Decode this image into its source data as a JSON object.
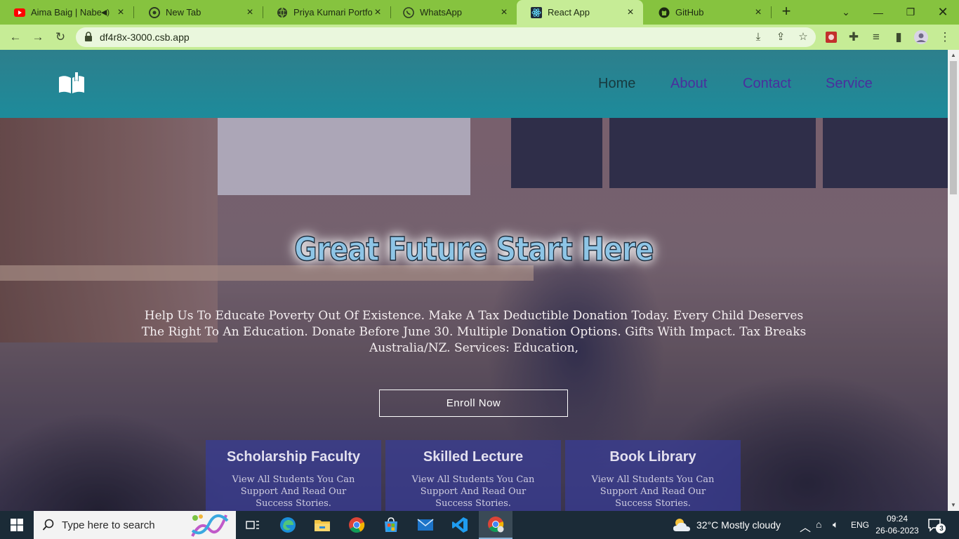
{
  "browser": {
    "tabs": [
      {
        "title": "Aima Baig | Nabeel",
        "icon": "youtube-icon"
      },
      {
        "title": "New Tab",
        "icon": "chrome-icon"
      },
      {
        "title": "Priya Kumari Portfolio",
        "icon": "globe-icon"
      },
      {
        "title": "WhatsApp",
        "icon": "whatsapp-icon"
      },
      {
        "title": "React App",
        "icon": "react-icon",
        "active": true
      },
      {
        "title": "GitHub",
        "icon": "github-icon"
      }
    ],
    "url": "df4r8x-3000.csb.app",
    "accent_color": "#86c33f",
    "toolbar_color": "#c6ec96"
  },
  "site": {
    "nav": {
      "home": "Home",
      "about": "About",
      "contact": "Contact",
      "service": "Service"
    },
    "hero": {
      "title": "Great Future Start Here",
      "text": "Help Us To Educate Poverty Out Of Existence. Make A Tax Deductible Donation Today. Every Child Deserves The Right To An Education. Donate Before June 30. Multiple Donation Options. Gifts With Impact. Tax Breaks Australia/NZ. Services: Education,",
      "button": "Enroll Now"
    },
    "cards": [
      {
        "title": "Scholarship Faculty",
        "text": "View All Students You Can Support And Read Our Success Stories."
      },
      {
        "title": "Skilled Lecture",
        "text": "View All Students You Can Support And Read Our Success Stories."
      },
      {
        "title": "Book Library",
        "text": "View All Students You Can Support And Read Our Success Stories."
      }
    ]
  },
  "taskbar": {
    "search_placeholder": "Type here to search",
    "weather": "32°C  Mostly cloudy",
    "language": "ENG",
    "time": "09:24",
    "date": "26-06-2023",
    "notification_count": "3"
  }
}
